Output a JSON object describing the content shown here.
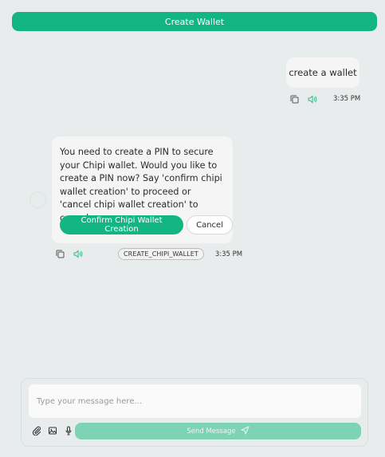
{
  "header": {
    "create_wallet_label": "Create Wallet"
  },
  "user_message": {
    "text": "create a wallet",
    "time": "3:35 PM",
    "icons": [
      "copy-icon",
      "speaker-icon"
    ]
  },
  "bot_message": {
    "text": "You need to create a PIN to secure your Chipi wallet. Would you like to create a PIN now? Say 'confirm chipi wallet creation' to proceed or 'cancel chipi wallet creation' to cancel.",
    "confirm_label": "Confirm Chipi Wallet Creation",
    "cancel_label": "Cancel",
    "action_tag": "CREATE_CHIPI_WALLET",
    "time": "3:35 PM",
    "icons": [
      "copy-icon",
      "speaker-icon"
    ]
  },
  "composer": {
    "placeholder": "Type your message here...",
    "send_label": "Send Message",
    "tools": [
      "paperclip-icon",
      "image-icon",
      "microphone-icon"
    ]
  },
  "colors": {
    "accent": "#13b583",
    "accent_disabled": "#7fd3b5",
    "background": "#e9ecec",
    "bubble": "#f5f5f5"
  }
}
